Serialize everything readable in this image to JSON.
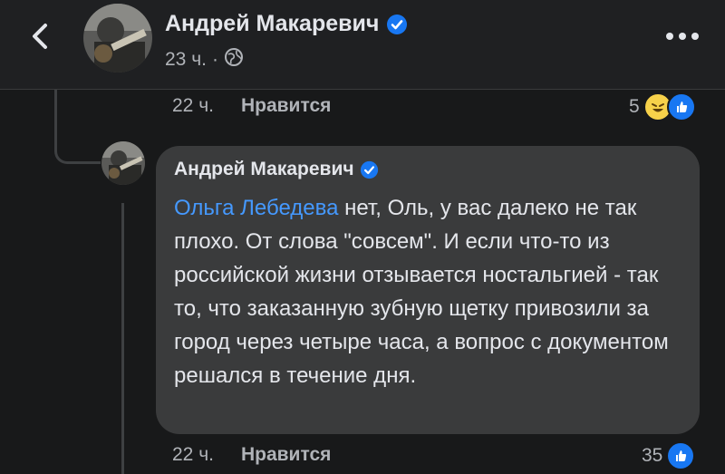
{
  "header": {
    "author_name": "Андрей Макаревич",
    "time": "23 ч.",
    "separator": "·",
    "icons": {
      "back": "chevron-left-icon",
      "verified": "verified-badge-icon",
      "privacy": "globe-icon",
      "more": "more-dots-icon"
    }
  },
  "comment1": {
    "time": "22 ч.",
    "like_label": "Нравится",
    "reaction_count": "5",
    "reactions": [
      "haha",
      "like"
    ]
  },
  "reply": {
    "author_name": "Андрей Макаревич",
    "mention": "Ольга Лебедева",
    "text": " нет, Оль, у вас далеко не так плохо. От слова \"совсем\". И если что-то из российской жизни отзывается ностальгией - так то, что заказанную зубную щетку привозили за город через четыре часа, а вопрос с документом решался в течение дня.",
    "time": "22 ч.",
    "like_label": "Нравится",
    "reaction_count": "35",
    "reactions": [
      "like"
    ]
  },
  "colors": {
    "background": "#18191a",
    "bubble": "#3a3b3c",
    "text_primary": "#e4e6eb",
    "text_secondary": "#b0b3b8",
    "mention": "#4599ff",
    "verified": "#1877f2",
    "like": "#1877f2",
    "haha": "#f7d14a"
  }
}
